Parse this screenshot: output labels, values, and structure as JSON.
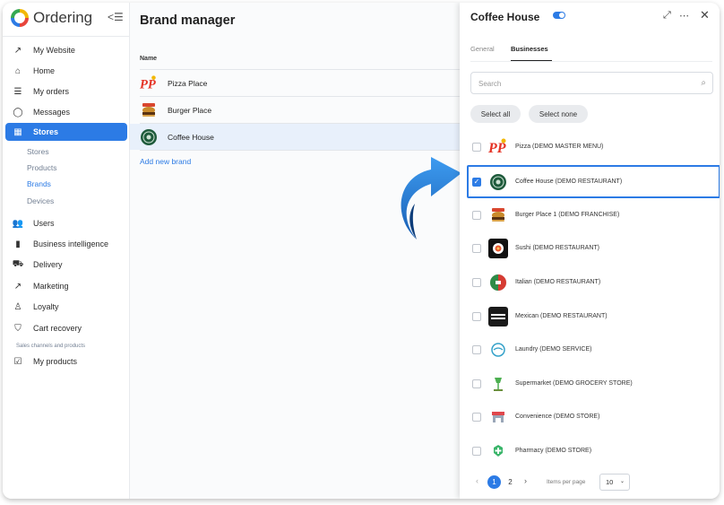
{
  "app": {
    "name": "Ordering"
  },
  "sidebar": {
    "items": [
      {
        "label": "My Website",
        "icon": "external-link-icon"
      },
      {
        "label": "Home",
        "icon": "home-icon"
      },
      {
        "label": "My orders",
        "icon": "list-icon"
      },
      {
        "label": "Messages",
        "icon": "chat-icon"
      },
      {
        "label": "Stores",
        "icon": "store-icon"
      },
      {
        "label": "Users",
        "icon": "users-icon"
      },
      {
        "label": "Business intelligence",
        "icon": "bar-chart-icon"
      },
      {
        "label": "Delivery",
        "icon": "truck-icon"
      },
      {
        "label": "Marketing",
        "icon": "trend-icon"
      },
      {
        "label": "Loyalty",
        "icon": "loyalty-icon"
      },
      {
        "label": "Cart recovery",
        "icon": "cart-icon"
      },
      {
        "label": "My products",
        "icon": "clipboard-icon"
      }
    ],
    "stores_sub": [
      "Stores",
      "Products",
      "Brands",
      "Devices"
    ],
    "section_label": "Sales channels and products"
  },
  "main": {
    "title": "Brand manager",
    "column_name": "Name",
    "brands": [
      {
        "name": "Pizza Place"
      },
      {
        "name": "Burger Place"
      },
      {
        "name": "Coffee House"
      }
    ],
    "add_label": "Add new brand"
  },
  "drawer": {
    "title": "Coffee House",
    "tabs": [
      "General",
      "Businesses"
    ],
    "search_placeholder": "Search",
    "select_all": "Select all",
    "select_none": "Select none",
    "businesses": [
      {
        "name": "Pizza (DEMO MASTER MENU)",
        "checked": false
      },
      {
        "name": "Coffee House (DEMO RESTAURANT)",
        "checked": true
      },
      {
        "name": "Burger Place 1 (DEMO FRANCHISE)",
        "checked": false
      },
      {
        "name": "Sushi (DEMO RESTAURANT)",
        "checked": false
      },
      {
        "name": "Italian (DEMO RESTAURANT)",
        "checked": false
      },
      {
        "name": "Mexican (DEMO RESTAURANT)",
        "checked": false
      },
      {
        "name": "Laundry (DEMO SERVICE)",
        "checked": false
      },
      {
        "name": "Supermarket (DEMO GROCERY STORE)",
        "checked": false
      },
      {
        "name": "Convenience (DEMO STORE)",
        "checked": false
      },
      {
        "name": "Pharmacy (DEMO STORE)",
        "checked": false
      }
    ],
    "pagination": {
      "pages": [
        "1",
        "2"
      ],
      "current": "1",
      "items_label": "Items per page",
      "per_page": "10"
    }
  },
  "colors": {
    "accent": "#2c7be5",
    "selected_row": "#e8f0fb"
  }
}
